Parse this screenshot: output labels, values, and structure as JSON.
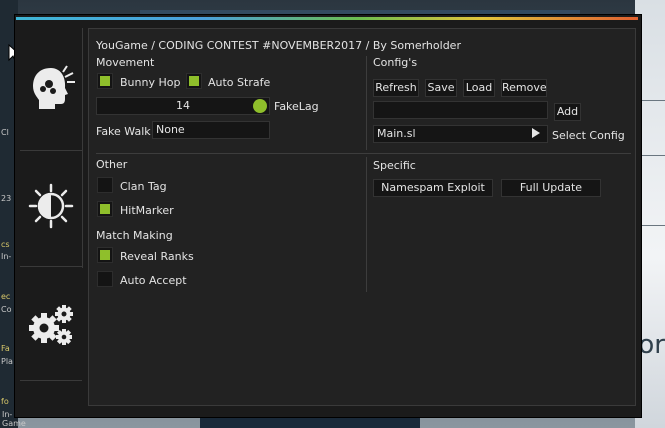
{
  "header": {
    "title": "YouGame / CODING CONTEST #NOVEMBER2017 / By Somerholder"
  },
  "sidebar": {
    "tabs": [
      {
        "icon": "head-icon"
      },
      {
        "icon": "brightness-icon"
      },
      {
        "icon": "gears-icon"
      }
    ]
  },
  "movement": {
    "heading": "Movement",
    "bunny_hop_label": "Bunny Hop",
    "bunny_hop_checked": true,
    "auto_strafe_label": "Auto Strafe",
    "auto_strafe_checked": true,
    "fakelag_value": "14",
    "fakelag_label": "FakeLag",
    "fake_walk_label": "Fake Walk",
    "fake_walk_value": "None"
  },
  "configs": {
    "heading": "Config's",
    "refresh_label": "Refresh",
    "save_label": "Save",
    "load_label": "Load",
    "remove_label": "Remove",
    "name_input_value": "",
    "add_label": "Add",
    "selected_config": "Main.sl",
    "select_config_label": "Select Config"
  },
  "other": {
    "heading": "Other",
    "clan_tag_label": "Clan Tag",
    "clan_tag_checked": false,
    "hitmarker_label": "HitMarker",
    "hitmarker_checked": true,
    "match_making_heading": "Match Making",
    "reveal_ranks_label": "Reveal Ranks",
    "reveal_ranks_checked": true,
    "auto_accept_label": "Auto Accept",
    "auto_accept_checked": false
  },
  "specific": {
    "heading": "Specific",
    "namespam_label": "Namespam Exploit",
    "full_update_label": "Full Update"
  },
  "background": {
    "left_labels": [
      "Cl",
      "23",
      "cs",
      "In-",
      "ec",
      "Co",
      "Fa",
      "Pla",
      "fo",
      "In-Game"
    ],
    "right_glyph": "or"
  },
  "colors": {
    "accent": "#8fbf2b",
    "panel": "#222222",
    "frame": "#1b1b1b"
  }
}
